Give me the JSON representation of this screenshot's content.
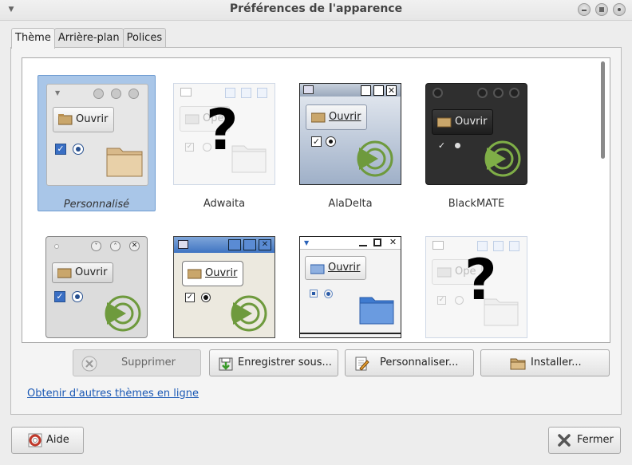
{
  "window": {
    "title": "Préférences de l'apparence"
  },
  "tabs": [
    {
      "label": "Thème",
      "active": true
    },
    {
      "label": "Arrière-plan",
      "active": false
    },
    {
      "label": "Polices",
      "active": false
    }
  ],
  "themes": [
    {
      "name": "Personnalisé",
      "selected": true,
      "button_label": "Ouvrir"
    },
    {
      "name": "Adwaita",
      "selected": false,
      "button_label": "Ope",
      "unknown": true
    },
    {
      "name": "AlaDelta",
      "selected": false,
      "button_label": "Ouvrir"
    },
    {
      "name": "BlackMATE",
      "selected": false,
      "button_label": "Ouvrir"
    },
    {
      "name": "",
      "selected": false,
      "button_label": "Ouvrir"
    },
    {
      "name": "",
      "selected": false,
      "button_label": "Ouvrir"
    },
    {
      "name": "",
      "selected": false,
      "button_label": "Ouvrir"
    },
    {
      "name": "",
      "selected": false,
      "button_label": "Ope",
      "unknown": true
    }
  ],
  "actions": {
    "delete": "Supprimer",
    "save_as": "Enregistrer sous...",
    "customize": "Personnaliser...",
    "install": "Installer..."
  },
  "more_themes_link": "Obtenir d'autres thèmes en ligne",
  "footer": {
    "help": "Aide",
    "close": "Fermer"
  },
  "icons": {
    "delete": "circle-x-icon",
    "save_as": "save-download-icon",
    "customize": "edit-document-icon",
    "install": "folder-icon",
    "help": "help-lifebuoy-icon",
    "close": "close-x-icon"
  },
  "colors": {
    "selection": "#a9c6e8",
    "link": "#1b59b5",
    "accent_green": "#6e9a3d"
  }
}
